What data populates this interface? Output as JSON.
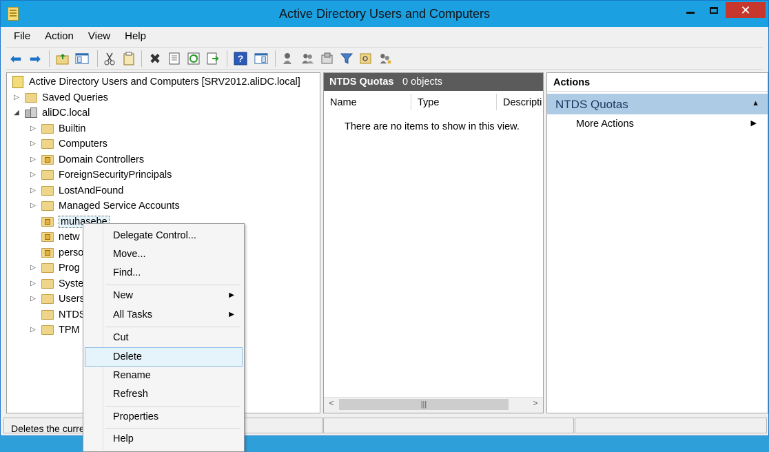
{
  "window": {
    "title": "Active Directory Users and Computers"
  },
  "menubar": [
    "File",
    "Action",
    "View",
    "Help"
  ],
  "tree": {
    "root": "Active Directory Users and Computers [SRV2012.aliDC.local]",
    "saved_queries": "Saved Queries",
    "domain": "aliDC.local",
    "children": [
      {
        "label": "Builtin",
        "expander": "▷"
      },
      {
        "label": "Computers",
        "expander": "▷"
      },
      {
        "label": "Domain Controllers",
        "expander": "▷"
      },
      {
        "label": "ForeignSecurityPrincipals",
        "expander": "▷"
      },
      {
        "label": "LostAndFound",
        "expander": "▷"
      },
      {
        "label": "Managed Service Accounts",
        "expander": "▷"
      },
      {
        "label": "muhasebe",
        "expander": ""
      },
      {
        "label": "netw",
        "expander": ""
      },
      {
        "label": "perso",
        "expander": ""
      },
      {
        "label": "Prog",
        "expander": "▷"
      },
      {
        "label": "Syste",
        "expander": "▷"
      },
      {
        "label": "Users",
        "expander": "▷"
      },
      {
        "label": "NTDS",
        "expander": ""
      },
      {
        "label": "TPM",
        "expander": "▷"
      }
    ]
  },
  "list": {
    "header_title": "NTDS Quotas",
    "header_count": "0 objects",
    "columns": [
      "Name",
      "Type",
      "Descripti"
    ],
    "empty_message": "There are no items to show in this view."
  },
  "actions": {
    "header": "Actions",
    "section": "NTDS Quotas",
    "more_actions": "More Actions"
  },
  "status": {
    "text": "Deletes the curre"
  },
  "context_menu": {
    "items": [
      "Delegate Control...",
      "Move...",
      "Find...",
      "New",
      "All Tasks",
      "Cut",
      "Delete",
      "Rename",
      "Refresh",
      "Properties",
      "Help"
    ]
  }
}
